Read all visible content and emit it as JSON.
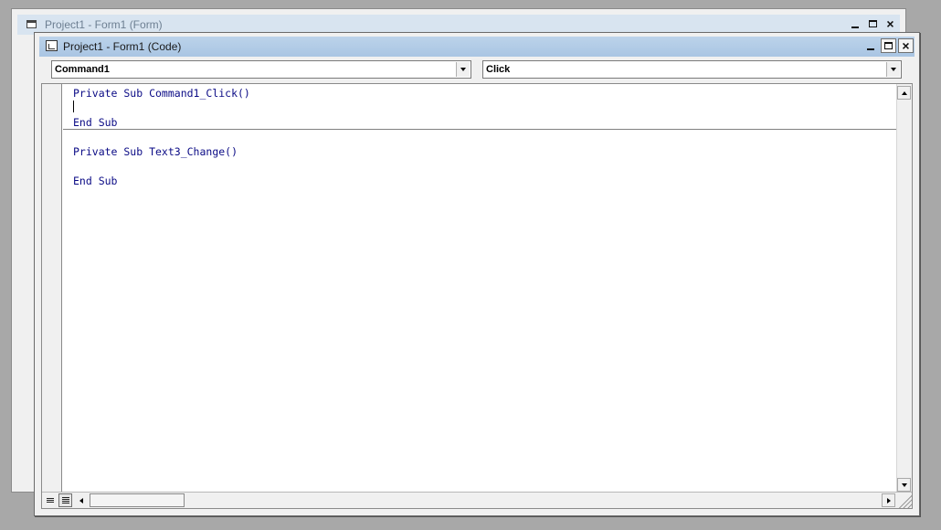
{
  "back_window": {
    "title": "Project1 - Form1 (Form)",
    "buttons": {
      "minimize": "_",
      "maximize": "□",
      "close": "×"
    }
  },
  "code_window": {
    "title": "Project1 - Form1 (Code)",
    "object_combo": {
      "value": "Command1"
    },
    "procedure_combo": {
      "value": "Click"
    },
    "code_lines": [
      "Private Sub Command1_Click()",
      "",
      "End Sub",
      "Private Sub Text3_Change()",
      "",
      "End Sub"
    ]
  },
  "colors": {
    "desktop": "#a8a8a8",
    "code_window_title": "#a9c5e3",
    "keyword_text": "#0a0a85"
  },
  "icons": {
    "back_window": "form-window-icon",
    "code_window": "code-window-icon",
    "view_buttons": [
      "procedure-view-icon",
      "full-module-view-icon"
    ]
  }
}
